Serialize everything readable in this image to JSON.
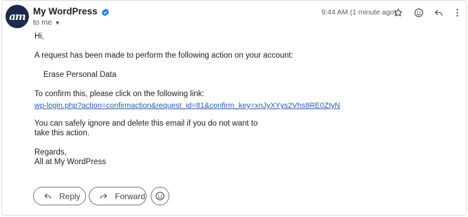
{
  "header": {
    "avatar_text": "am",
    "sender_name": "My WordPress",
    "recipient_label": "to me",
    "timestamp": "9:44 AM (1 minute ago)",
    "icons": [
      "star-icon",
      "emoji-icon",
      "reply-icon",
      "more-vert-icon"
    ],
    "verified_color": "#1a73e8"
  },
  "email": {
    "greeting": "Hi,",
    "intro": "A request has been made to perform the following action on your account:",
    "action": "Erase Personal Data",
    "confirm_prompt": "To confirm this, please click on the following link:",
    "link": "wp-login.php?action=confirmaction&request_id=81&confirm_key=xnJyXYys2Vhs8RE0ZtyN",
    "ignore_line1": "You can safely ignore and delete this email if you do not want to",
    "ignore_line2": "take this action.",
    "signoff": "Regards,",
    "signature": "All at My WordPress"
  },
  "actions": {
    "reply_label": "Reply",
    "forward_label": "Forward"
  }
}
